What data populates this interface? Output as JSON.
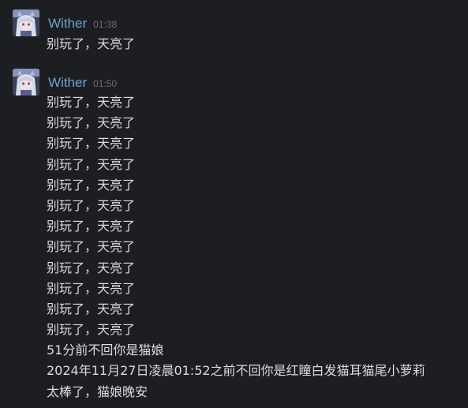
{
  "messages": [
    {
      "sender": "Wither",
      "time": "01:38",
      "lines": [
        "别玩了，天亮了"
      ]
    },
    {
      "sender": "Wither",
      "time": "01:50",
      "lines": [
        "别玩了，天亮了",
        "别玩了，天亮了",
        "别玩了，天亮了",
        "别玩了，天亮了",
        "别玩了，天亮了",
        "别玩了，天亮了",
        "别玩了，天亮了",
        "别玩了，天亮了",
        "别玩了，天亮了",
        "别玩了，天亮了",
        "别玩了，天亮了",
        "别玩了，天亮了",
        "51分前不回你是猫娘",
        "2024年11月27日凌晨01:52之前不回你是红瞳白发猫耳猫尾小萝莉",
        "太棒了，猫娘晚安"
      ]
    }
  ],
  "colors": {
    "background": "#1d1e22",
    "sender_name": "#6fa3cc",
    "timestamp": "#6c6e76",
    "message_text": "#dcdcdc"
  },
  "icons": {
    "avatar": "anime-avatar-icon"
  }
}
